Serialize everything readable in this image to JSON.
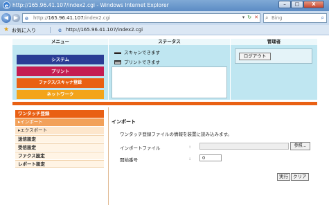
{
  "window": {
    "title": "http://165.96.41.107/index2.cgi - Windows Internet Explorer",
    "minimize": "–",
    "maximize": "□",
    "close": "X"
  },
  "browser": {
    "url_prefix": "http://",
    "url_host": "165.96.41.107",
    "url_path": "/index2.cgi",
    "search_placeholder": "Bing",
    "favorites_label": "お気に入り",
    "tab_title": "http://165.96.41.107/index2.cgi"
  },
  "header": {
    "menu_heading": "メニュー",
    "status_heading": "ステータス",
    "admin_heading": "管理者",
    "menu_buttons": {
      "system": "システム",
      "print": "プリント",
      "fax": "ファクス/スキャナ登録",
      "network": "ネットワーク"
    },
    "status_scan": "スキャンできます",
    "status_print": "プリントできます",
    "logout": "ログアウト"
  },
  "sidenav": {
    "head": "ワンタッチ登録",
    "import": "▸インポート",
    "export": "▸エクスポート",
    "send": "送信設定",
    "receive": "受信設定",
    "fax": "ファクス設定",
    "report": "レポート設定"
  },
  "main": {
    "title": "インポート",
    "description": "ワンタッチ登録ファイルの情報を装置に読み込みます。",
    "file_label": "インポートファイル",
    "start_label": "開始番号",
    "colon": ":",
    "browse": "参照...",
    "start_value": "0"
  },
  "actions": {
    "execute": "実行",
    "clear": "クリア"
  },
  "colors": {
    "titlebar": "#5c8cc4",
    "header_bg": "#bfe6f1",
    "system": "#2a3d95",
    "print": "#c41d52",
    "fax": "#e96013",
    "network": "#f3a41a",
    "accent": "#e96013"
  }
}
